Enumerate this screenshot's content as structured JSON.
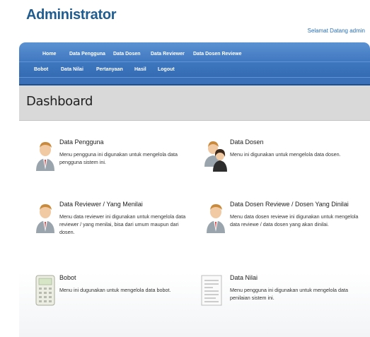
{
  "header": {
    "app_title": "Administrator",
    "welcome": "Selamat Datang admin"
  },
  "nav": {
    "row1": [
      "Home",
      "Data Pengguna",
      "Data Dosen",
      "Data Reviewer",
      "Data Dosen Reviewe"
    ],
    "row2": [
      "Bobot",
      "Data Nilai",
      "Pertanyaan",
      "Hasil",
      "Logout"
    ]
  },
  "dashboard": {
    "title": "Dashboard"
  },
  "cards": [
    {
      "title": "Data Pengguna",
      "desc": "Menu pengguna ini digunakan untuk mengelola data pengguna sistem ini.",
      "icon": "user-icon"
    },
    {
      "title": "Data Dosen",
      "desc": "Menu ini digunakan untuk mengelola data dosen.",
      "icon": "users-icon"
    },
    {
      "title": "Data Reviewer / Yang Menilai",
      "desc": "Menu data reviewer ini digunakan untuk mengelola data reviewer / yang menilai, bisa dari umum maupun dari dosen.",
      "icon": "user-icon"
    },
    {
      "title": "Data Dosen Reviewe / Dosen Yang Dinilai",
      "desc": "Menu data dosen reviewe ini digunakan untuk mengelola data reviewe / data dosen yang akan dinilai.",
      "icon": "user-icon"
    },
    {
      "title": "Bobot",
      "desc": "Menu ini dugunakan untuk mengelola data bobot.",
      "icon": "calculator-icon"
    },
    {
      "title": "Data Nilai",
      "desc": "Menu pengguna ini digunakan untuk mengelola data penilaian sistem ini.",
      "icon": "document-icon"
    }
  ],
  "colors": {
    "brand": "#1f5c8f",
    "nav": "#3f77bf",
    "header_bg": "#d9d9d9"
  }
}
